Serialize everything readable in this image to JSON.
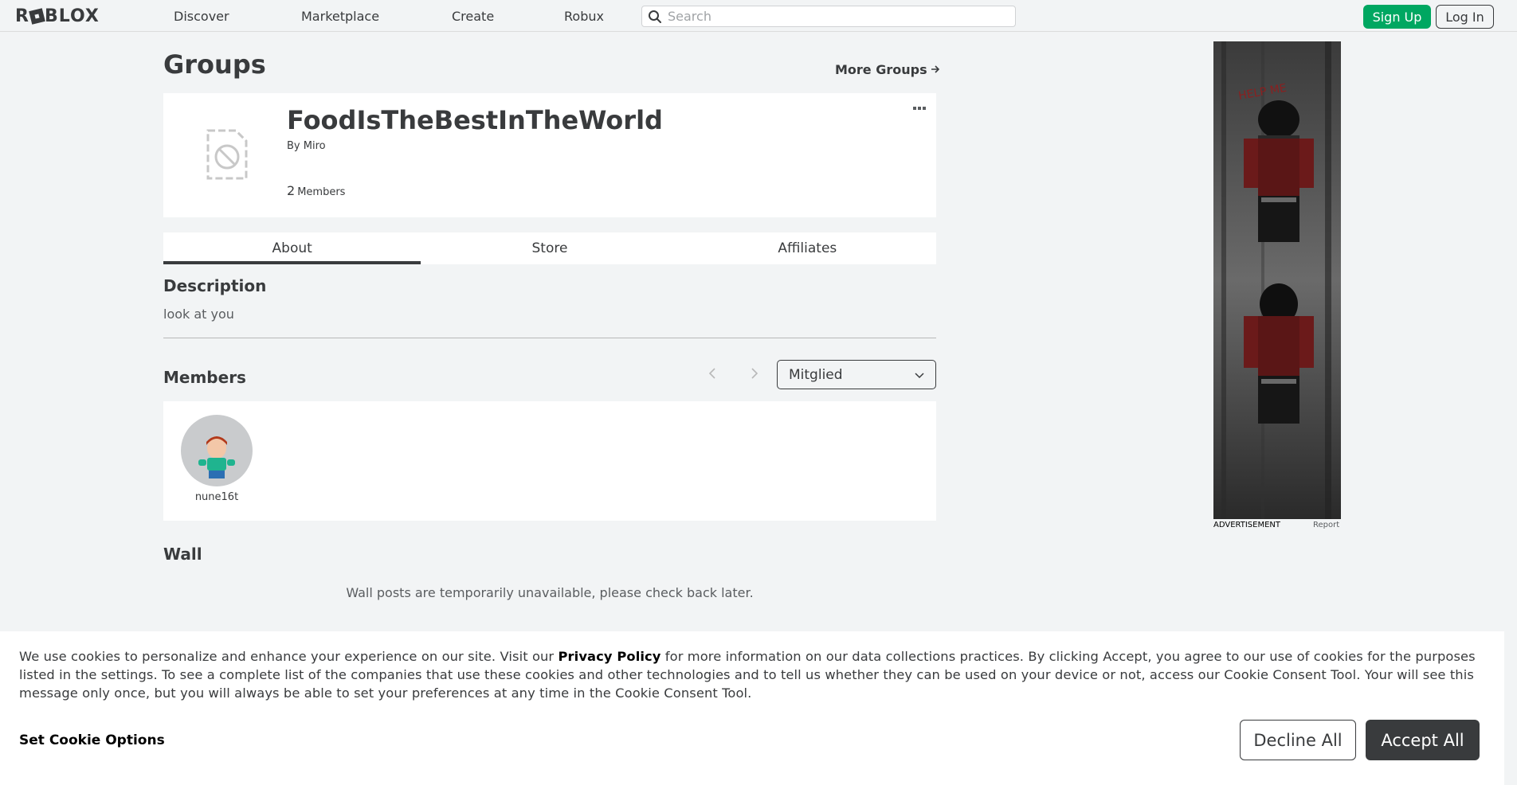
{
  "nav": {
    "logo": "ROBLOX",
    "links": [
      "Discover",
      "Marketplace",
      "Create",
      "Robux"
    ],
    "search_placeholder": "Search",
    "signup": "Sign Up",
    "login": "Log In"
  },
  "page": {
    "title": "Groups",
    "more_groups": "More Groups"
  },
  "group": {
    "name": "FoodIsTheBestInTheWorld",
    "by_prefix": "By",
    "owner": "Miro",
    "member_count": "2",
    "member_label": "Members"
  },
  "tabs": [
    "About",
    "Store",
    "Affiliates"
  ],
  "about": {
    "description_heading": "Description",
    "description_text": "look at you"
  },
  "members_section": {
    "heading": "Members",
    "role_selected": "Mitglied",
    "members": [
      {
        "name": "nune16t"
      }
    ]
  },
  "wall": {
    "heading": "Wall",
    "message": "Wall posts are temporarily unavailable, please check back later."
  },
  "ad": {
    "label": "ADVERTISEMENT",
    "report": "Report",
    "scrawl": "HELP ME"
  },
  "cookie": {
    "text_pre": "We use cookies to personalize and enhance your experience on our site. Visit our ",
    "privacy_link": "Privacy Policy",
    "text_post": " for more information on our data collections practices. By clicking Accept, you agree to our use of cookies for the purposes listed in the settings. To see a complete list of the companies that use these cookies and other technologies and to tell us whether they can be used on your device or not, access our Cookie Consent Tool. Your will see this message only once, but you will always be able to set your preferences at any time in the Cookie Consent Tool.",
    "set_options": "Set Cookie Options",
    "decline": "Decline All",
    "accept": "Accept All"
  },
  "colors": {
    "background": "#f2f4f5",
    "text": "#393b3d",
    "signup_green": "#00a761",
    "accept_dark": "#393b3d"
  }
}
